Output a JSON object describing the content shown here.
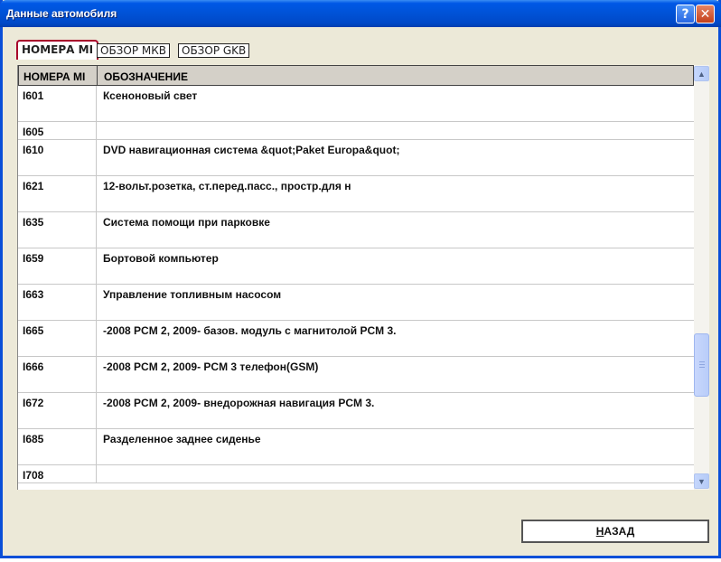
{
  "window": {
    "title": "Данные автомобиля",
    "help_glyph": "?",
    "close_glyph": "✕"
  },
  "tabs": [
    {
      "label": "НОМЕРА MI",
      "active": true
    },
    {
      "label": "ОБЗОР МКВ",
      "active": false
    },
    {
      "label": "ОБЗОР GKB",
      "active": false
    }
  ],
  "table": {
    "columns": [
      "НОМЕРА MI",
      "ОБОЗНАЧЕНИЕ"
    ],
    "rows": [
      {
        "code": "I601",
        "desc": "Ксеноновый свет"
      },
      {
        "code": "I605",
        "desc": ""
      },
      {
        "code": "I610",
        "desc": "DVD навигационная система &quot;Paket Europa&quot;"
      },
      {
        "code": "I621",
        "desc": "12-вольт.розетка, ст.перед.пасс., простр.для н"
      },
      {
        "code": "I635",
        "desc": "Система помощи при парковке"
      },
      {
        "code": "I659",
        "desc": "Бортовой компьютер"
      },
      {
        "code": "I663",
        "desc": "Управление топливным насосом"
      },
      {
        "code": "I665",
        "desc": "-2008 PCM 2, 2009- базов. модуль с магнитолой PCM 3."
      },
      {
        "code": "I666",
        "desc": "-2008 PCM 2, 2009- PCM 3 телефон(GSM)"
      },
      {
        "code": "I672",
        "desc": "-2008 PCM 2, 2009- внедорожная навигация PCM 3."
      },
      {
        "code": "I685",
        "desc": "Разделенное заднее сиденье"
      },
      {
        "code": "I708",
        "desc": ""
      }
    ]
  },
  "scrollbar": {
    "up_glyph": "▲",
    "down_glyph": "▼"
  },
  "back_button": {
    "hotkey": "Н",
    "rest": "АЗАД"
  }
}
